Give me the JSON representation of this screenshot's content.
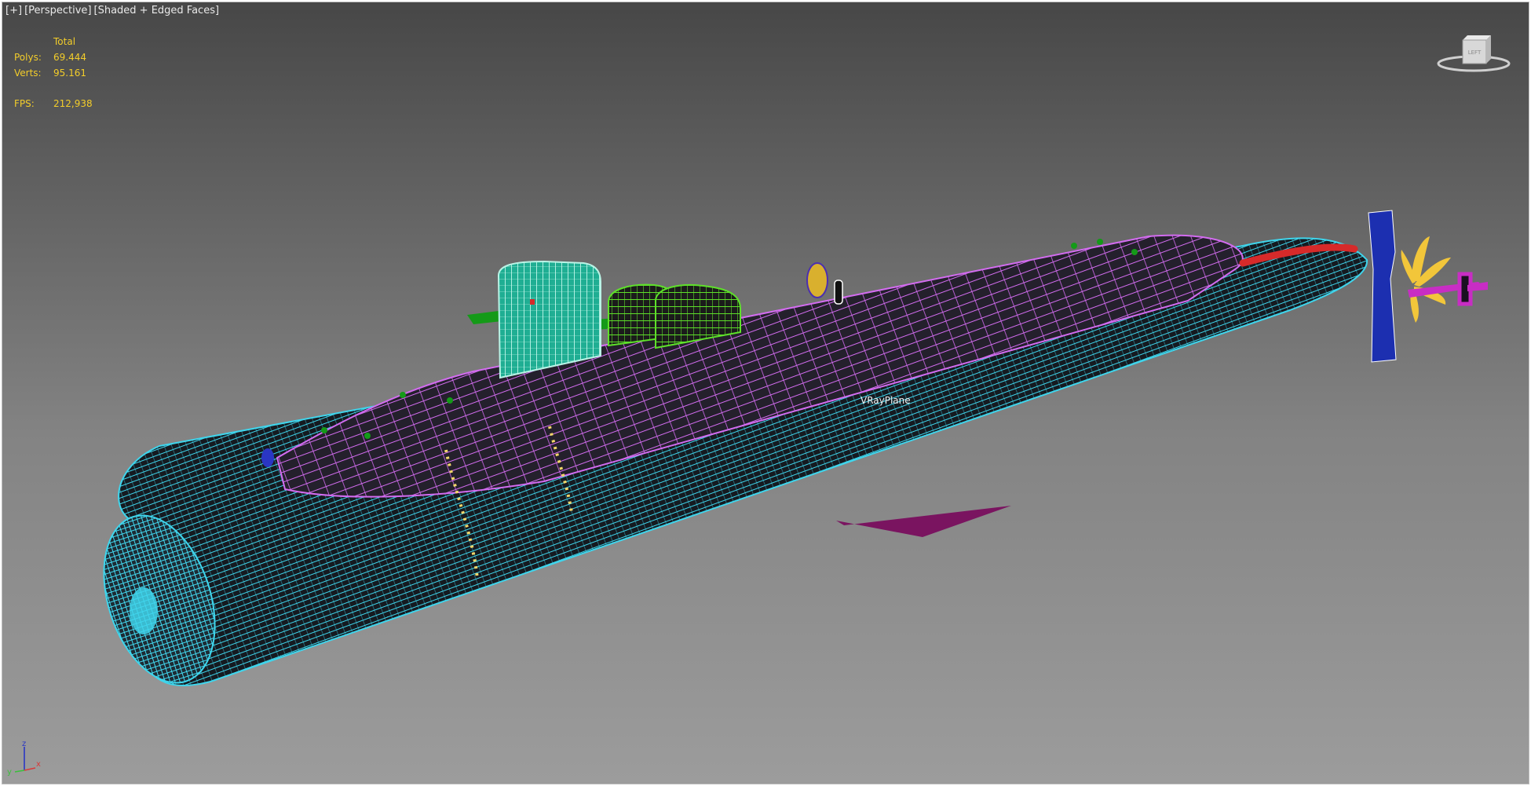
{
  "viewport": {
    "labels": [
      "+",
      "Perspective",
      "Shaded + Edged Faces"
    ]
  },
  "stats": {
    "header": "Total",
    "rows": [
      {
        "label": "Polys:",
        "value": "69.444"
      },
      {
        "label": "Verts:",
        "value": "95.161"
      }
    ],
    "fps_label": "FPS:",
    "fps_value": "212,938"
  },
  "scene": {
    "object_label": "VRayPlane",
    "colors": {
      "hull_wire": "#3fd5ec",
      "deck_wire": "#d36cf0",
      "sail": "#23c6a4",
      "hatch_green": "#5ee02a",
      "fins_green": "#149a18",
      "plane": "#7a1460",
      "rudder": "#1c2fb0",
      "propeller": "#f2c63a",
      "red_stripe": "#d62a2a"
    }
  },
  "viewcube": {
    "face_label": "LEFT",
    "icon": "viewcube-icon"
  },
  "axis": {
    "x": "x",
    "y": "y",
    "z": "z"
  }
}
